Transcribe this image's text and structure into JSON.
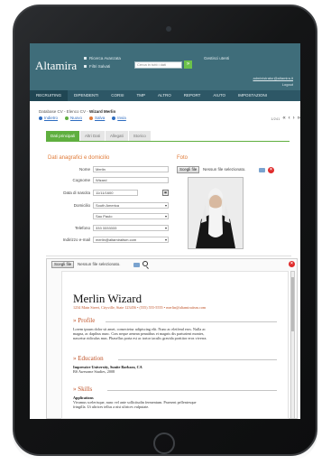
{
  "app": {
    "logo": "Altamira",
    "top_links": [
      "Ricerca Avanzata",
      "Filtri Salvati"
    ],
    "search_placeholder": "Cerca in tutti i dati",
    "search_go": "»",
    "settings": "Gestisci utenti",
    "user_email": "administrator@altamira.it",
    "logout": "Logout"
  },
  "nav": {
    "items": [
      "Recruiting",
      "Dipendenti",
      "Corsi",
      "TMP",
      "Altro",
      "Report",
      "Aiuto",
      "Impostazioni"
    ]
  },
  "record": {
    "breadcrumb_prefix": "Database CV - Elenco CV - ",
    "breadcrumb_current": "Wizard Merlin",
    "actions": [
      {
        "label": "Indietro",
        "color": "#2d6cc0"
      },
      {
        "label": "Nuovo",
        "color": "#5faf3f"
      },
      {
        "label": "Salva",
        "color": "#e07a37"
      },
      {
        "label": "Invia",
        "color": "#2d6cc0"
      }
    ],
    "pager_count": "1/241",
    "pager_icons": [
      "«",
      "‹",
      "›",
      "»"
    ]
  },
  "tabs": [
    "Dati principali",
    "Altri Dati",
    "Allegati",
    "Storico"
  ],
  "form": {
    "section_title": "Dati anagrafici e domicilio",
    "photo_title": "Foto",
    "fields": [
      {
        "label": "Nome",
        "value": "Merlin"
      },
      {
        "label": "Cognome",
        "value": "Wizard"
      },
      {
        "label": "Data di nascita",
        "value": "11/11/1600"
      },
      {
        "label": "Domicilio",
        "value": "South America"
      },
      {
        "label": "",
        "value": "Sao Paulo"
      },
      {
        "label": "Telefono",
        "value": "333 3333333"
      },
      {
        "label": "Indirizzo e-mail",
        "value": "merlin@altamiraitsm.com"
      }
    ]
  },
  "upload": {
    "button": "Scegli file",
    "no_file": "Nessun file selezionato."
  },
  "cv": {
    "name": "Merlin Wizard",
    "contact": "1234 Main Street, Cityville, State 123456 • (555) 555-5555 • merlin@altamiraitsm.com",
    "sections": [
      {
        "title": "Profile",
        "lines": [
          "Lorem ipsum dolor sit amet, consectetur adipiscing elit. Nunc ac eleifend eros. Nulla ac",
          "magna, ac dapibus nunc. Cras neque aenean penatibus et magnis dis parturient montes,",
          "nascetur ridiculus mus. Phasellus porta est ac tortor iaculis gravida porttitor eros viverra."
        ]
      },
      {
        "title": "Education",
        "lines": [
          "Impressive University, Sunite Barbara, CA",
          "BS Awesome Studies, 2008"
        ]
      },
      {
        "title": "Skills",
        "lines": [
          "Applications",
          "Vivamus scelerisque, nunc vel ante sollicitudin fermentum. Praesent pellentesque",
          "fringilla. Ut ultrices tellus a nisi ultrices vulputate."
        ]
      }
    ]
  }
}
